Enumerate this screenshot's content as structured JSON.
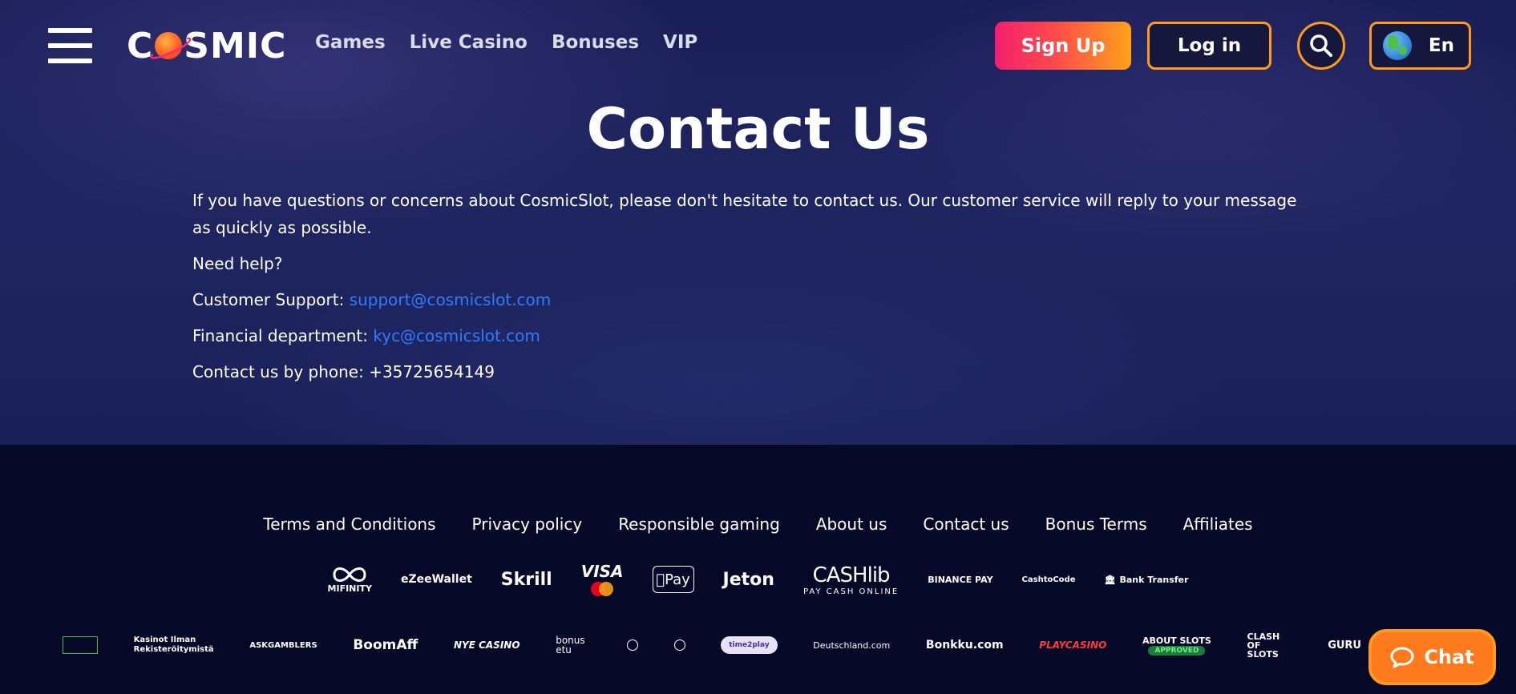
{
  "header": {
    "logo_text_start": "C",
    "logo_text_end": "SMIC",
    "nav": [
      "Games",
      "Live Casino",
      "Bonuses",
      "VIP"
    ],
    "signup_label": "Sign Up",
    "login_label": "Log in",
    "language": "En"
  },
  "main": {
    "title": "Contact Us",
    "intro": "If you have questions or concerns about CosmicSlot, please don't hesitate to contact us. Our customer service will reply to your message as quickly as possible.",
    "need_help": "Need help?",
    "support_label": "Customer Support: ",
    "support_email": "support@cosmicslot.com",
    "financial_label": "Financial department: ",
    "financial_email": "kyc@cosmicslot.com",
    "phone_text": "Contact us by phone: +35725654149"
  },
  "footer": {
    "links": [
      "Terms and Conditions",
      "Privacy policy",
      "Responsible gaming",
      "About us",
      "Contact us",
      "Bonus Terms",
      "Affiliates"
    ],
    "payments": {
      "mifinity": "MIFINITY",
      "ezeewallet": "eZeeWallet",
      "skrill": "Skrill",
      "visa": "VISA",
      "applepay": "Pay",
      "jeton": "Jeton",
      "cashlib": "CASHlib",
      "cashlib_sub": "PAY CASH ONLINE",
      "binance": "BINANCE PAY",
      "cashtocode": "CashtoCode",
      "bank": "Bank Transfer"
    },
    "partners": {
      "kasinot": "Kasinot Ilman Rekisteröitymistä",
      "askgamblers": "ASKGAMBLERS",
      "boomaff": "BoomAff",
      "nyecasino": "NYE CASINO",
      "bonusetu": "bonus etu",
      "time2play": "time2play",
      "deutschland": "Deutschland.com",
      "bonkku": "Bonkku.com",
      "playcasino": "PLAYCASINO",
      "aboutslots": "ABOUT SLOTS",
      "aboutslots_badge": "APPROVED",
      "clashofslots": "CLASH OF SLOTS",
      "casinoguru": "GURU"
    },
    "chat_label": "Chat"
  },
  "colors": {
    "accent_orange": "#ff9a1a",
    "signup_gradient_start": "#f31f6e",
    "link_blue": "#2f7cff",
    "footer_bg": "#060828"
  }
}
